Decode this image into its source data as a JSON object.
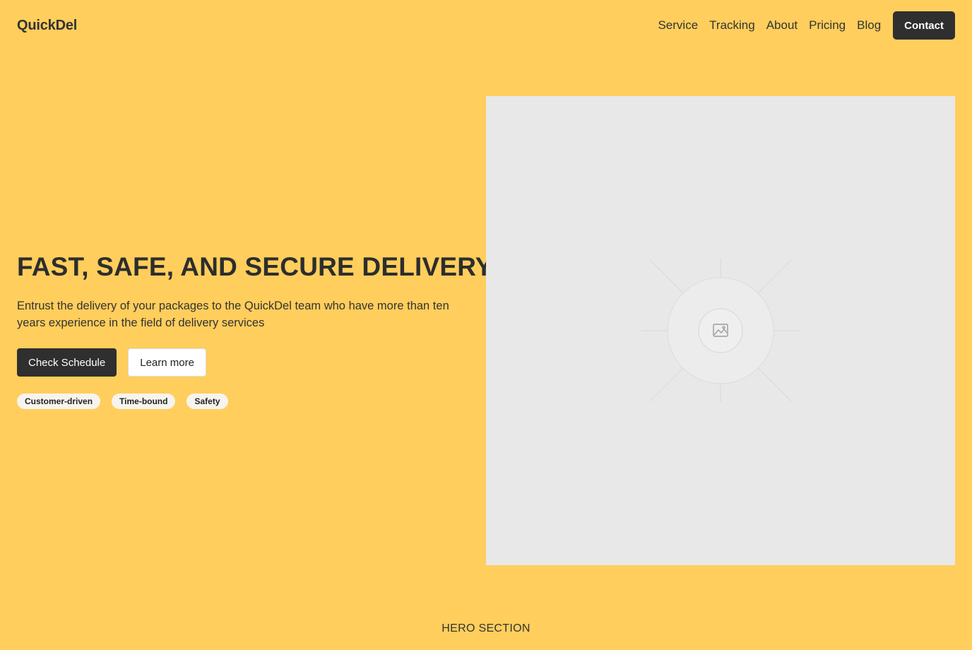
{
  "header": {
    "logo": "QuickDel",
    "nav": [
      "Service",
      "Tracking",
      "About",
      "Pricing",
      "Blog"
    ],
    "contact_label": "Contact"
  },
  "hero": {
    "title": "FAST, SAFE, AND SECURE DELIVERY",
    "subtitle": "Entrust the delivery of your packages to the QuickDel team who have more than ten years experience in the field of delivery services",
    "primary_button": "Check Schedule",
    "secondary_button": "Learn more",
    "tags": [
      "Customer-driven",
      "Time-bound",
      "Safety"
    ],
    "image_icon": "image-placeholder-icon"
  },
  "section_label": "HERO SECTION",
  "colors": {
    "background": "#FFCE5C",
    "dark": "#2f2f2f",
    "placeholder": "#e8e8e8"
  }
}
